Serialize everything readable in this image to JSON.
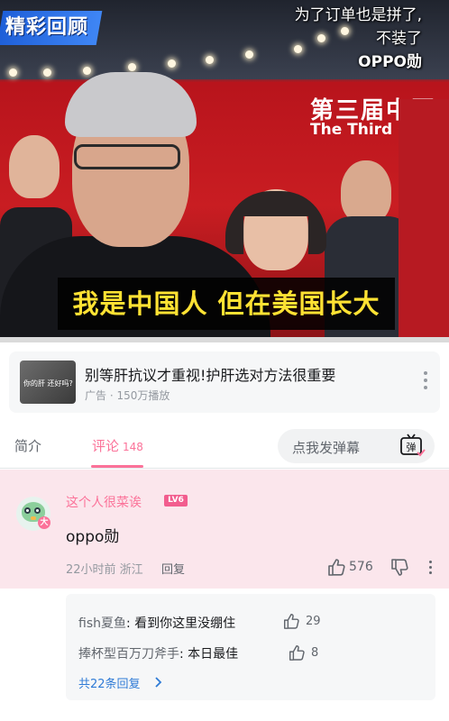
{
  "video": {
    "badge": "精彩回顾",
    "caption_lines": [
      "为了订单也是拼了,",
      "不装了",
      "OPPO勋"
    ],
    "banner_cn": "第三届中国",
    "banner_en": "The Third China",
    "subtitle": "我是中国人 但在美国长大",
    "progress_fraction": 0.0
  },
  "ad": {
    "thumb_text": "你的肝 还好吗?",
    "title": "别等肝抗议才重视!护肝选对方法很重要",
    "meta": "广告 · 150万播放"
  },
  "tabs": {
    "intro": "简介",
    "comments": "评论",
    "comments_count": "148",
    "danmaku_placeholder": "点我发弹幕",
    "danmaku_button": "弹"
  },
  "comment": {
    "username": "这个人很菜诶",
    "level": "LV6",
    "vip_badge": "大",
    "text": "oppo勋",
    "time_location": "22小时前 浙江",
    "reply_label": "回复",
    "likes": "576"
  },
  "replies": {
    "items": [
      {
        "name": "fish夏鱼",
        "sep": ": ",
        "text": "看到你这里没绷住",
        "likes": "29"
      },
      {
        "name": "捧杯型百万刀斧手",
        "sep": ": ",
        "text": "本日最佳",
        "likes": "8"
      }
    ],
    "total_label": "共22条回复"
  },
  "colors": {
    "accent": "#fb7299",
    "link": "#2f7bd6",
    "subtitle_yellow": "#ffe233",
    "badge_blue": "#1e5fd8"
  }
}
